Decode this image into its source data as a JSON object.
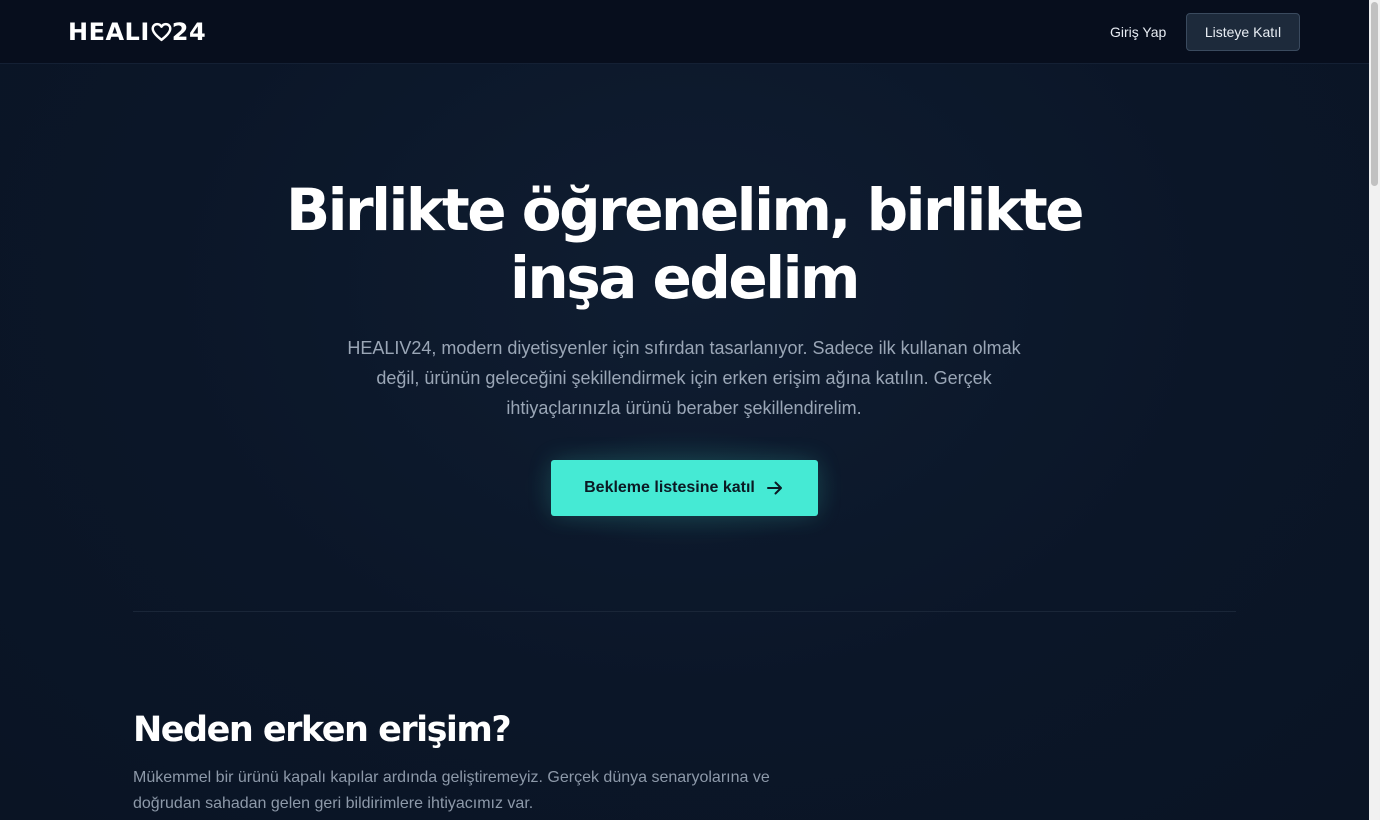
{
  "header": {
    "logo_before": "HEALI",
    "logo_after": "24",
    "login_label": "Giriş Yap",
    "join_label": "Listeye Katıl"
  },
  "hero": {
    "title": "Birlikte öğrenelim, birlikte inşa edelim",
    "subtitle": "HEALIV24, modern diyetisyenler için sıfırdan tasarlanıyor. Sadece ilk kullanan olmak değil, ürünün geleceğini şekillendirmek için erken erişim ağına katılın. Gerçek ihtiyaçlarınızla ürünü beraber şekillendirelim.",
    "cta_label": "Bekleme listesine katıl"
  },
  "why": {
    "title": "Neden erken erişim?",
    "text": "Mükemmel bir ürünü kapalı kapılar ardında geliştiremeyiz. Gerçek dünya senaryolarına ve doğrudan sahadan gelen geri bildirimlere ihtiyacımız var."
  },
  "colors": {
    "accent": "#45ead4",
    "background": "#0b1526",
    "header_background": "#070e1d"
  },
  "icons": {
    "logo_heart": "heart-outline-icon",
    "cta_arrow": "arrow-right-icon"
  }
}
